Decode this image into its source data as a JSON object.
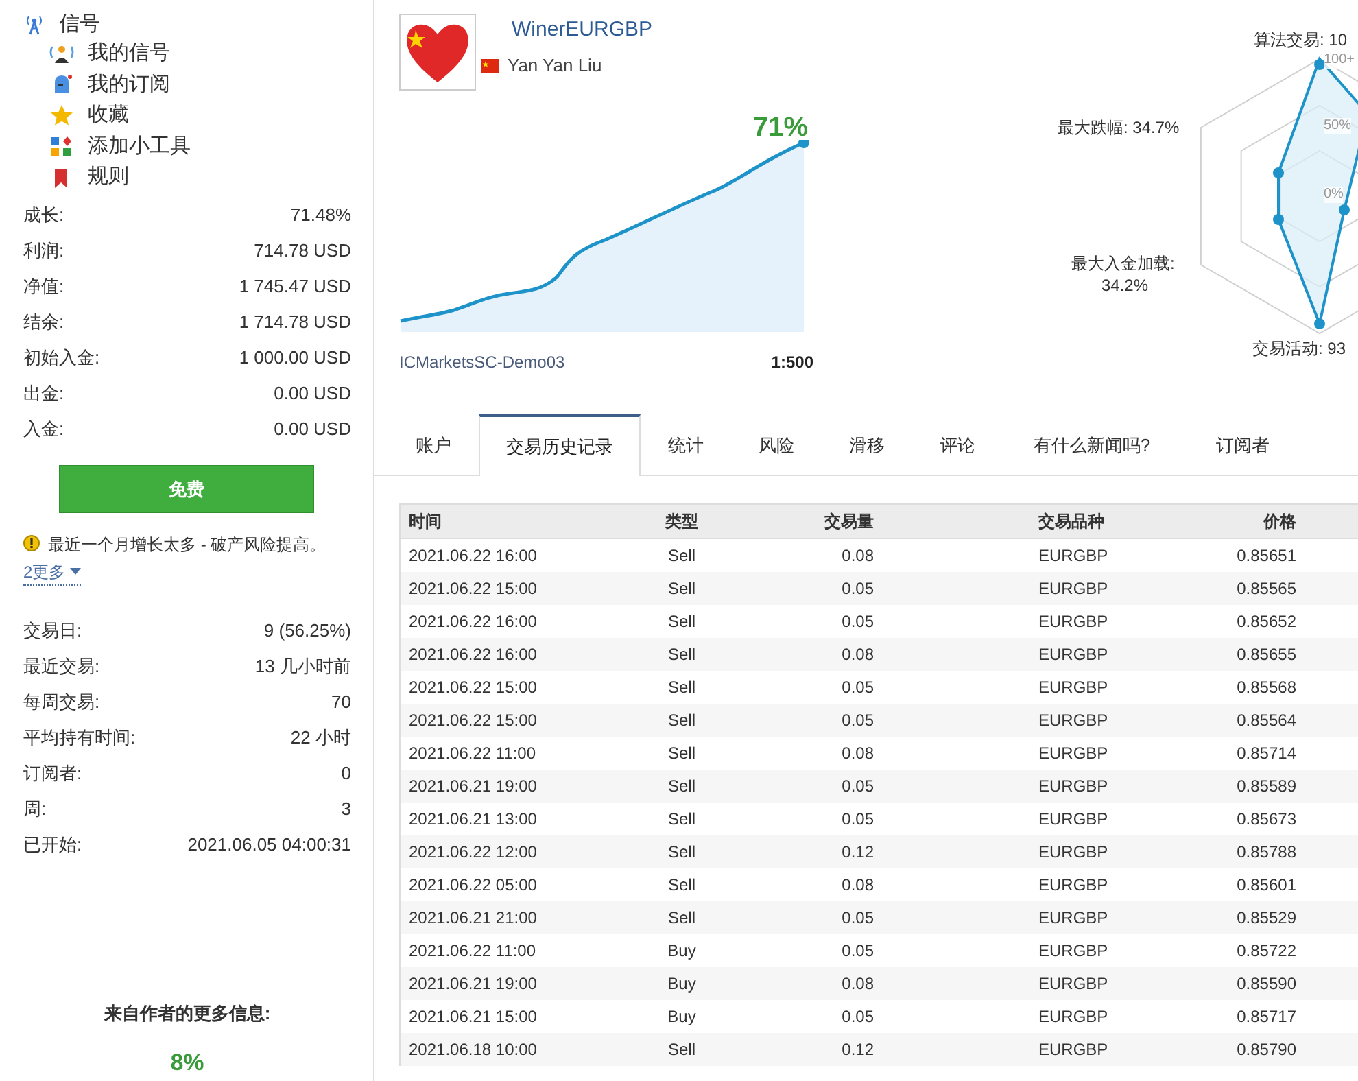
{
  "sidebar": {
    "header": "信号",
    "items": [
      "我的信号",
      "我的订阅",
      "收藏",
      "添加小工具",
      "规则"
    ],
    "stats": [
      {
        "label": "成长:",
        "value": "71.48%"
      },
      {
        "label": "利润:",
        "value": "714.78 USD"
      },
      {
        "label": "净值:",
        "value": "1 745.47 USD"
      },
      {
        "label": "结余:",
        "value": "1 714.78 USD"
      },
      {
        "label": "初始入金:",
        "value": "1 000.00 USD"
      },
      {
        "label": "出金:",
        "value": "0.00 USD"
      },
      {
        "label": "入金:",
        "value": "0.00 USD"
      }
    ],
    "button": "免费",
    "warning": {
      "text": "最近一个月增长太多 - 破产风险提高。",
      "more": "2更多"
    },
    "stats2": [
      {
        "label": "交易日:",
        "value": "9 (56.25%)"
      },
      {
        "label": "最近交易:",
        "value": "13 几小时前"
      },
      {
        "label": "每周交易:",
        "value": "70"
      },
      {
        "label": "平均持有时间:",
        "value": "22 小时"
      },
      {
        "label": "订阅者:",
        "value": "0"
      },
      {
        "label": "周:",
        "value": "3"
      },
      {
        "label": "已开始:",
        "value": "2021.06.05 04:00:31"
      }
    ],
    "more_info_title": "来自作者的更多信息:",
    "more_info_value": "8%"
  },
  "profile": {
    "title": "WinerEURGBP",
    "author": "Yan Yan Liu",
    "growth": "71%",
    "server": "ICMarketsSC-Demo03",
    "leverage": "1:500"
  },
  "radar": {
    "labels": [
      "算法交易: 10",
      "最大跌幅: 34.7%",
      "最大入金加载:",
      "34.2%",
      "交易活动: 93"
    ],
    "ticks": [
      "100+",
      "50%",
      "0%"
    ]
  },
  "tabs": [
    {
      "label": "账户",
      "selected": false
    },
    {
      "label": "交易历史记录",
      "selected": true
    },
    {
      "label": "统计",
      "selected": false
    },
    {
      "label": "风险",
      "selected": false
    },
    {
      "label": "滑移",
      "selected": false
    },
    {
      "label": "评论",
      "selected": false
    },
    {
      "label": "有什么新闻吗?",
      "selected": false
    },
    {
      "label": "订阅者",
      "selected": false
    }
  ],
  "table": {
    "columns": [
      "时间",
      "类型",
      "交易量",
      "交易品种",
      "价格"
    ],
    "rows": [
      [
        "2021.06.22 16:00",
        "Sell",
        "0.08",
        "EURGBP",
        "0.85651"
      ],
      [
        "2021.06.22 15:00",
        "Sell",
        "0.05",
        "EURGBP",
        "0.85565"
      ],
      [
        "2021.06.22 16:00",
        "Sell",
        "0.05",
        "EURGBP",
        "0.85652"
      ],
      [
        "2021.06.22 16:00",
        "Sell",
        "0.08",
        "EURGBP",
        "0.85655"
      ],
      [
        "2021.06.22 15:00",
        "Sell",
        "0.05",
        "EURGBP",
        "0.85568"
      ],
      [
        "2021.06.22 15:00",
        "Sell",
        "0.05",
        "EURGBP",
        "0.85564"
      ],
      [
        "2021.06.22 11:00",
        "Sell",
        "0.08",
        "EURGBP",
        "0.85714"
      ],
      [
        "2021.06.21 19:00",
        "Sell",
        "0.05",
        "EURGBP",
        "0.85589"
      ],
      [
        "2021.06.21 13:00",
        "Sell",
        "0.05",
        "EURGBP",
        "0.85673"
      ],
      [
        "2021.06.22 12:00",
        "Sell",
        "0.12",
        "EURGBP",
        "0.85788"
      ],
      [
        "2021.06.22 05:00",
        "Sell",
        "0.08",
        "EURGBP",
        "0.85601"
      ],
      [
        "2021.06.21 21:00",
        "Sell",
        "0.05",
        "EURGBP",
        "0.85529"
      ],
      [
        "2021.06.22 11:00",
        "Buy",
        "0.05",
        "EURGBP",
        "0.85722"
      ],
      [
        "2021.06.21 19:00",
        "Buy",
        "0.08",
        "EURGBP",
        "0.85590"
      ],
      [
        "2021.06.21 15:00",
        "Buy",
        "0.05",
        "EURGBP",
        "0.85717"
      ],
      [
        "2021.06.18 10:00",
        "Sell",
        "0.12",
        "EURGBP",
        "0.85790"
      ]
    ]
  }
}
